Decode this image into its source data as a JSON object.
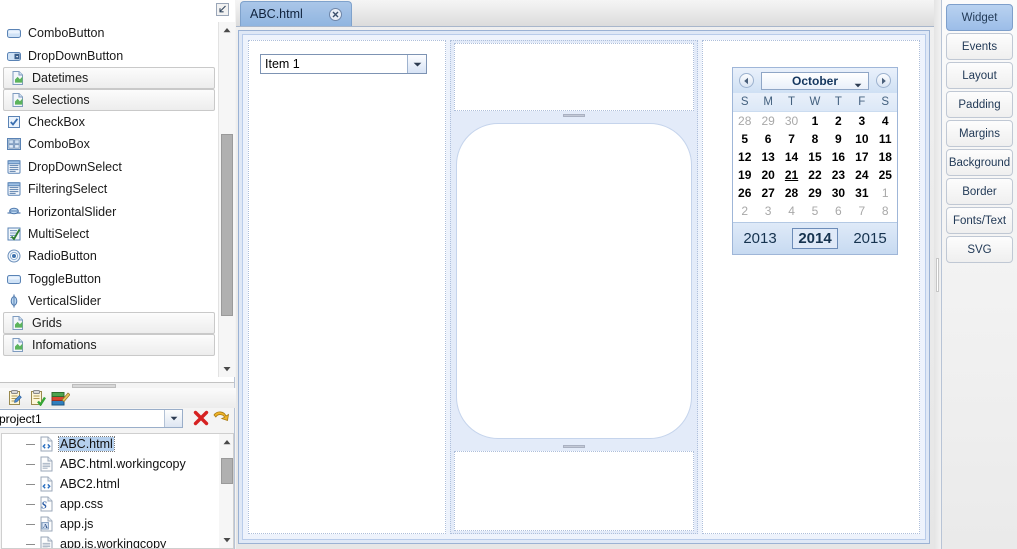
{
  "palette": {
    "collapse_icon": "collapse-arrow-icon",
    "items": [
      {
        "label": "ComboButton",
        "icon": "combo-button-icon",
        "group": false
      },
      {
        "label": "DropDownButton",
        "icon": "dropdown-button-icon",
        "group": false
      },
      {
        "label": "Datetimes",
        "icon": "category-icon",
        "group": true
      },
      {
        "label": "Selections",
        "icon": "category-icon",
        "group": true
      },
      {
        "label": "CheckBox",
        "icon": "checkbox-icon",
        "group": false
      },
      {
        "label": "ComboBox",
        "icon": "combobox-icon",
        "group": false
      },
      {
        "label": "DropDownSelect",
        "icon": "dropdownselect-icon",
        "group": false
      },
      {
        "label": "FilteringSelect",
        "icon": "filteringselect-icon",
        "group": false
      },
      {
        "label": "HorizontalSlider",
        "icon": "horizontal-slider-icon",
        "group": false
      },
      {
        "label": "MultiSelect",
        "icon": "multiselect-icon",
        "group": false
      },
      {
        "label": "RadioButton",
        "icon": "radio-button-icon",
        "group": false
      },
      {
        "label": "ToggleButton",
        "icon": "toggle-button-icon",
        "group": false
      },
      {
        "label": "VerticalSlider",
        "icon": "vertical-slider-icon",
        "group": false
      },
      {
        "label": "Grids",
        "icon": "category-icon",
        "group": true
      },
      {
        "label": "Infomations",
        "icon": "category-icon",
        "group": true
      }
    ]
  },
  "project": {
    "toolbar": [
      {
        "name": "new-project-icon"
      },
      {
        "name": "validate-project-icon"
      },
      {
        "name": "build-project-icon"
      }
    ],
    "combo_value": "project1",
    "actions": [
      {
        "name": "delete-icon"
      },
      {
        "name": "refresh-icon"
      }
    ],
    "files": [
      {
        "label": "ABC.html",
        "icon": "html-file-icon",
        "selected": true
      },
      {
        "label": "ABC.html.workingcopy",
        "icon": "text-file-icon",
        "selected": false
      },
      {
        "label": "ABC2.html",
        "icon": "html-file-icon",
        "selected": false
      },
      {
        "label": "app.css",
        "icon": "css-file-icon",
        "selected": false
      },
      {
        "label": "app.js",
        "icon": "js-file-icon",
        "selected": false
      },
      {
        "label": "app.js.workingcopy",
        "icon": "text-file-icon",
        "selected": false
      }
    ]
  },
  "editor": {
    "tab": {
      "label": "ABC.html",
      "close_icon": "close-icon"
    },
    "combo_item": {
      "value": "Item 1",
      "arrow_icon": "chevron-down-icon"
    }
  },
  "calendar": {
    "prev_icon": "chevron-left-icon",
    "next_icon": "chevron-right-icon",
    "month": "October",
    "month_arrow_icon": "chevron-down-icon",
    "dow": [
      "S",
      "M",
      "T",
      "W",
      "T",
      "F",
      "S"
    ],
    "weeks": [
      [
        {
          "d": "28",
          "adj": true
        },
        {
          "d": "29",
          "adj": true
        },
        {
          "d": "30",
          "adj": true
        },
        {
          "d": "1"
        },
        {
          "d": "2"
        },
        {
          "d": "3"
        },
        {
          "d": "4"
        }
      ],
      [
        {
          "d": "5"
        },
        {
          "d": "6"
        },
        {
          "d": "7"
        },
        {
          "d": "8"
        },
        {
          "d": "9"
        },
        {
          "d": "10"
        },
        {
          "d": "11"
        }
      ],
      [
        {
          "d": "12"
        },
        {
          "d": "13"
        },
        {
          "d": "14"
        },
        {
          "d": "15"
        },
        {
          "d": "16"
        },
        {
          "d": "17"
        },
        {
          "d": "18"
        }
      ],
      [
        {
          "d": "19"
        },
        {
          "d": "20"
        },
        {
          "d": "21",
          "today": true
        },
        {
          "d": "22"
        },
        {
          "d": "23"
        },
        {
          "d": "24"
        },
        {
          "d": "25"
        }
      ],
      [
        {
          "d": "26"
        },
        {
          "d": "27"
        },
        {
          "d": "28"
        },
        {
          "d": "29"
        },
        {
          "d": "30"
        },
        {
          "d": "31"
        },
        {
          "d": "1",
          "adj": true
        }
      ],
      [
        {
          "d": "2",
          "adj": true
        },
        {
          "d": "3",
          "adj": true
        },
        {
          "d": "4",
          "adj": true
        },
        {
          "d": "5",
          "adj": true
        },
        {
          "d": "6",
          "adj": true
        },
        {
          "d": "7",
          "adj": true
        },
        {
          "d": "8",
          "adj": true
        }
      ]
    ],
    "years": [
      {
        "label": "2013",
        "selected": false
      },
      {
        "label": "2014",
        "selected": true
      },
      {
        "label": "2015",
        "selected": false
      }
    ]
  },
  "sidebar": {
    "items": [
      {
        "label": "Widget",
        "active": true
      },
      {
        "label": "Events",
        "active": false
      },
      {
        "label": "Layout",
        "active": false
      },
      {
        "label": "Padding",
        "active": false
      },
      {
        "label": "Margins",
        "active": false
      },
      {
        "label": "Background",
        "active": false
      },
      {
        "label": "Border",
        "active": false
      },
      {
        "label": "Fonts/Text",
        "active": false
      },
      {
        "label": "SVG",
        "active": false
      }
    ]
  },
  "colors": {
    "accent": "#90b5e0",
    "panel_border": "#b8c4d6",
    "canvas_bg": "#dfe8f6",
    "selection": "#b5d0ee"
  }
}
